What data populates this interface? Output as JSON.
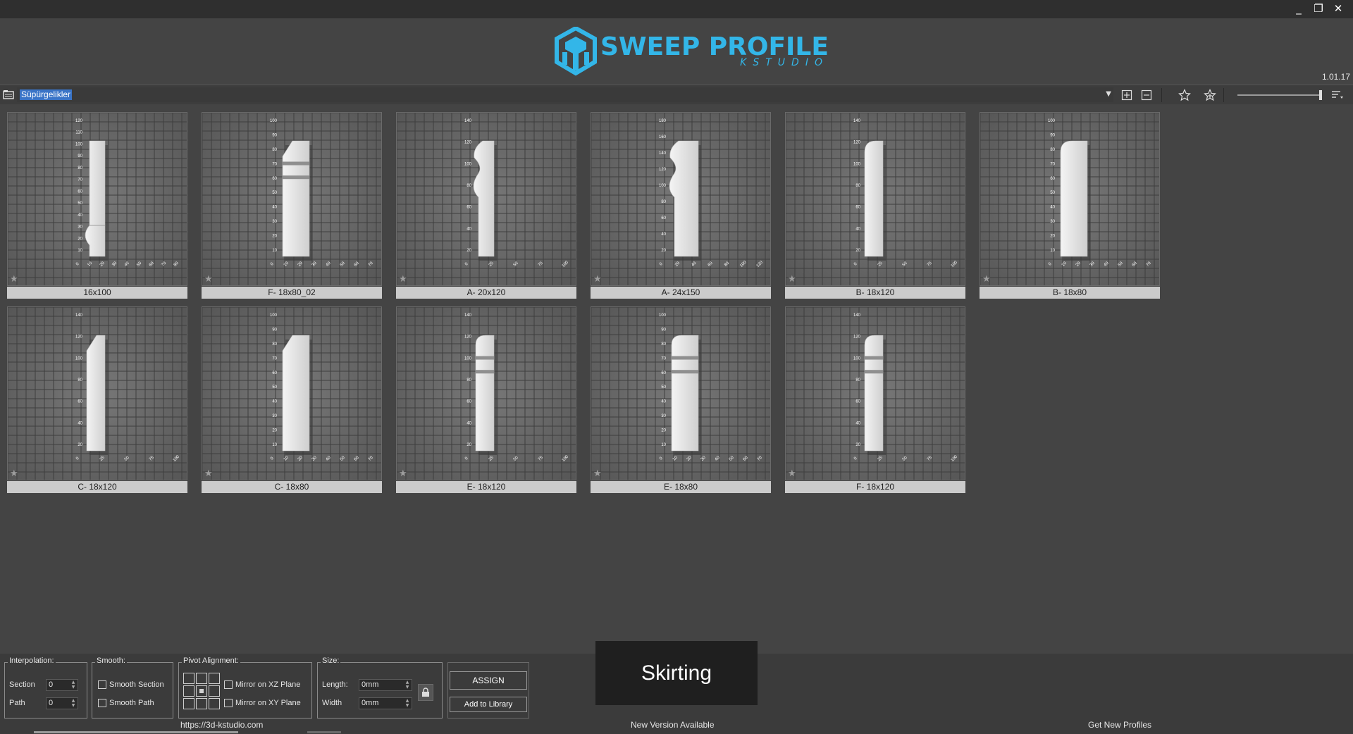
{
  "window": {
    "controls": {
      "minimize": "_",
      "restore": "❐",
      "close": "✕"
    }
  },
  "header": {
    "logo_main": "SWEEP PROFILE",
    "logo_sub": "KSTUDIO",
    "version": "1.01.17",
    "brand_color": "#33b6e8"
  },
  "toolbar": {
    "folder_icon": "folder-icon",
    "path": "Süpürgelikler",
    "icons": [
      "expand-icon",
      "collapse-icon",
      "star-icon",
      "star-add-icon",
      "sort-icon"
    ]
  },
  "profiles": [
    {
      "label": "16x100",
      "ticks_y": [
        "120",
        "110",
        "100",
        "90",
        "80",
        "70",
        "60",
        "50",
        "40",
        "30",
        "20",
        "10"
      ],
      "ticks_x": [
        "0",
        "10",
        "20",
        "30",
        "40",
        "50",
        "60",
        "70",
        "80"
      ]
    },
    {
      "label": "F- 18x80_02",
      "ticks_y": [
        "100",
        "90",
        "80",
        "70",
        "60",
        "50",
        "40",
        "30",
        "20",
        "10"
      ],
      "ticks_x": [
        "0",
        "10",
        "20",
        "30",
        "40",
        "50",
        "60",
        "70"
      ]
    },
    {
      "label": "A- 20x120",
      "ticks_y": [
        "140",
        "120",
        "100",
        "80",
        "60",
        "40",
        "20"
      ],
      "ticks_x": [
        "0",
        "25",
        "50",
        "75",
        "100"
      ]
    },
    {
      "label": "A- 24x150",
      "ticks_y": [
        "180",
        "160",
        "140",
        "120",
        "100",
        "80",
        "60",
        "40",
        "20"
      ],
      "ticks_x": [
        "0",
        "20",
        "40",
        "60",
        "80",
        "100",
        "120"
      ]
    },
    {
      "label": "B- 18x120",
      "ticks_y": [
        "140",
        "120",
        "100",
        "80",
        "60",
        "40",
        "20"
      ],
      "ticks_x": [
        "0",
        "25",
        "50",
        "75",
        "100"
      ]
    },
    {
      "label": "B- 18x80",
      "ticks_y": [
        "100",
        "90",
        "80",
        "70",
        "60",
        "50",
        "40",
        "30",
        "20",
        "10"
      ],
      "ticks_x": [
        "0",
        "10",
        "20",
        "30",
        "40",
        "50",
        "60",
        "70"
      ]
    },
    {
      "label": "C- 18x120",
      "ticks_y": [
        "140",
        "120",
        "100",
        "80",
        "60",
        "40",
        "20"
      ],
      "ticks_x": [
        "0",
        "25",
        "50",
        "75",
        "100"
      ]
    },
    {
      "label": "C- 18x80",
      "ticks_y": [
        "100",
        "90",
        "80",
        "70",
        "60",
        "50",
        "40",
        "30",
        "20",
        "10"
      ],
      "ticks_x": [
        "0",
        "10",
        "20",
        "30",
        "40",
        "50",
        "60",
        "70"
      ]
    },
    {
      "label": "E- 18x120",
      "ticks_y": [
        "140",
        "120",
        "100",
        "80",
        "60",
        "40",
        "20"
      ],
      "ticks_x": [
        "0",
        "25",
        "50",
        "75",
        "100"
      ]
    },
    {
      "label": "E- 18x80",
      "ticks_y": [
        "100",
        "90",
        "80",
        "70",
        "60",
        "50",
        "40",
        "30",
        "20",
        "10"
      ],
      "ticks_x": [
        "0",
        "10",
        "20",
        "30",
        "40",
        "50",
        "60",
        "70"
      ]
    },
    {
      "label": "F- 18x120",
      "ticks_y": [
        "140",
        "120",
        "100",
        "80",
        "60",
        "40",
        "20"
      ],
      "ticks_x": [
        "0",
        "25",
        "50",
        "75",
        "100"
      ]
    }
  ],
  "panel": {
    "interpolation": {
      "title": "Interpolation:",
      "section_label": "Section",
      "section_value": "0",
      "path_label": "Path",
      "path_value": "0"
    },
    "smooth": {
      "title": "Smooth:",
      "smooth_section": "Smooth Section",
      "smooth_path": "Smooth Path"
    },
    "pivot": {
      "title": "Pivot Alignment:",
      "mirror_xz": "Mirror on XZ Plane",
      "mirror_xy": "Mirror on XY Plane"
    },
    "size": {
      "title": "Size:",
      "length_label": "Length:",
      "length_value": "0mm",
      "width_label": "Width",
      "width_value": "0mm"
    },
    "assign": "ASSIGN",
    "add_to_library": "Add to Library",
    "category": "Skirting"
  },
  "footer": {
    "website": "https://3d-kstudio.com",
    "new_version": "New Version Available",
    "get_profiles": "Get New Profiles"
  }
}
